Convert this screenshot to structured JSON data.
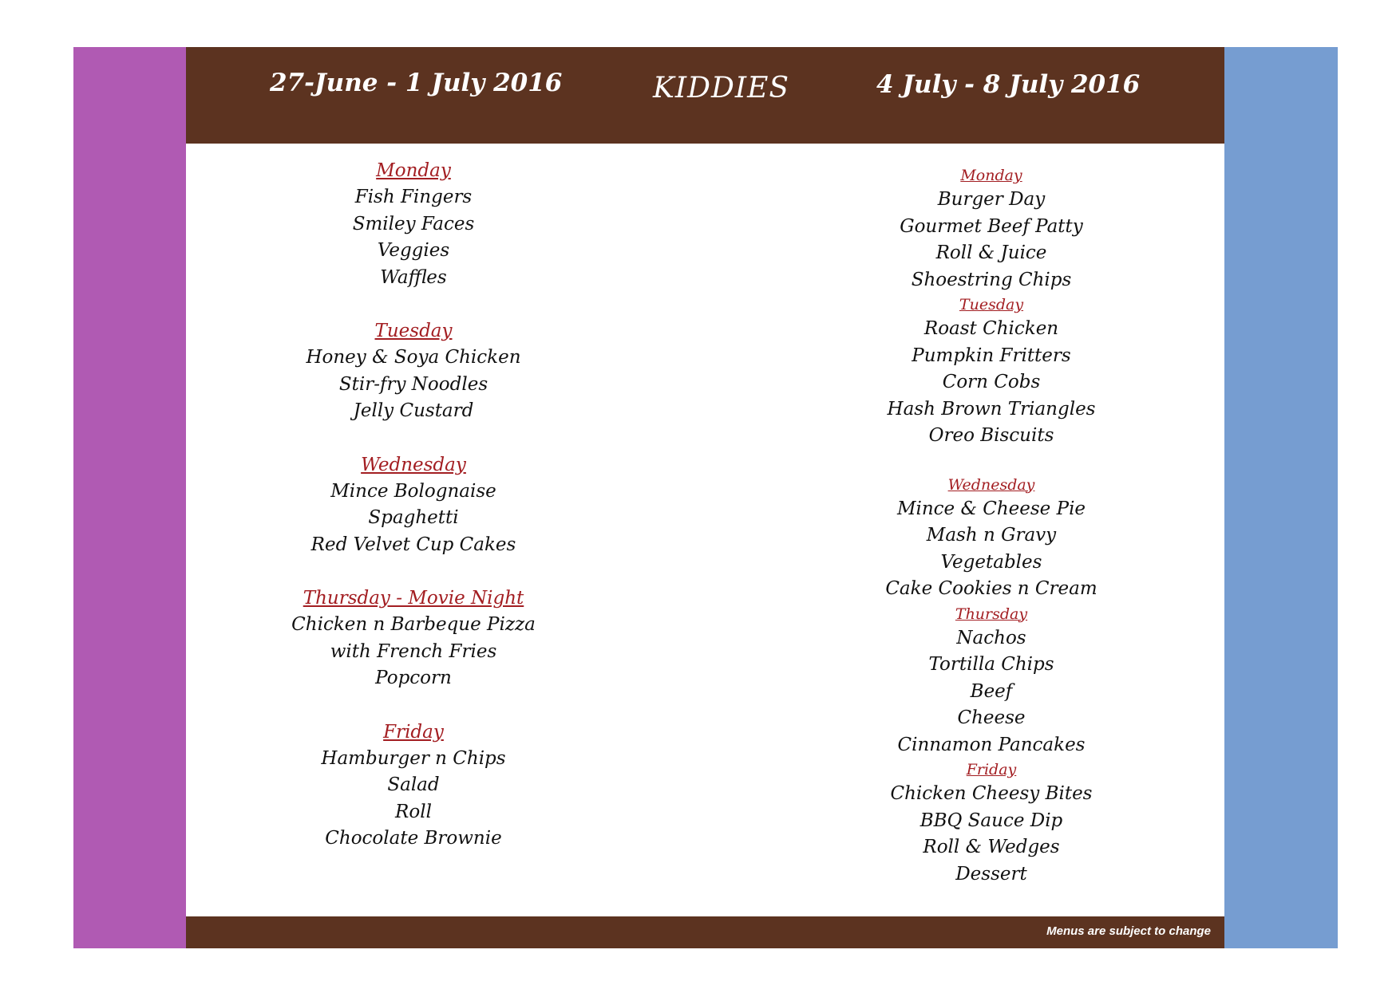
{
  "header": {
    "date_left": "27-June - 1 July 2016",
    "title": "KIDDIES",
    "date_right": "4 July - 8 July 2016"
  },
  "footer": {
    "note": "Menus are subject to change"
  },
  "colors": {
    "left_bar": "#b05ab3",
    "right_bar": "#769dd1",
    "band": "#5c3320",
    "day_heading": "#a31e22"
  },
  "week1": [
    {
      "day": "Monday",
      "items": [
        "Fish Fingers",
        "Smiley Faces",
        "Veggies",
        "Waffles"
      ]
    },
    {
      "day": "Tuesday",
      "items": [
        "Honey & Soya Chicken",
        "Stir-fry Noodles",
        "Jelly Custard"
      ]
    },
    {
      "day": "Wednesday",
      "items": [
        "Mince Bolognaise",
        "Spaghetti",
        "Red Velvet Cup Cakes"
      ]
    },
    {
      "day": "Thursday - Movie Night",
      "items": [
        "Chicken n Barbeque Pizza",
        "with French Fries",
        "Popcorn"
      ]
    },
    {
      "day": "Friday",
      "items": [
        "Hamburger n Chips",
        "Salad",
        "Roll",
        "Chocolate Brownie"
      ]
    }
  ],
  "week2": [
    {
      "day": "Monday",
      "items": [
        "Burger Day",
        "Gourmet Beef Patty",
        "Roll & Juice",
        "Shoestring Chips"
      ]
    },
    {
      "day": "Tuesday",
      "items": [
        "Roast Chicken",
        "Pumpkin Fritters",
        "Corn Cobs",
        "Hash Brown Triangles",
        "Oreo Biscuits"
      ]
    },
    {
      "day": "Wednesday",
      "items": [
        "Mince & Cheese Pie",
        "Mash n Gravy",
        "Vegetables",
        "Cake Cookies n Cream"
      ]
    },
    {
      "day": "Thursday",
      "items": [
        "Nachos",
        "Tortilla Chips",
        "Beef",
        "Cheese",
        "Cinnamon Pancakes"
      ]
    },
    {
      "day": "Friday",
      "items": [
        "Chicken Cheesy Bites",
        "BBQ Sauce Dip",
        "Roll & Wedges",
        "Dessert"
      ]
    }
  ]
}
